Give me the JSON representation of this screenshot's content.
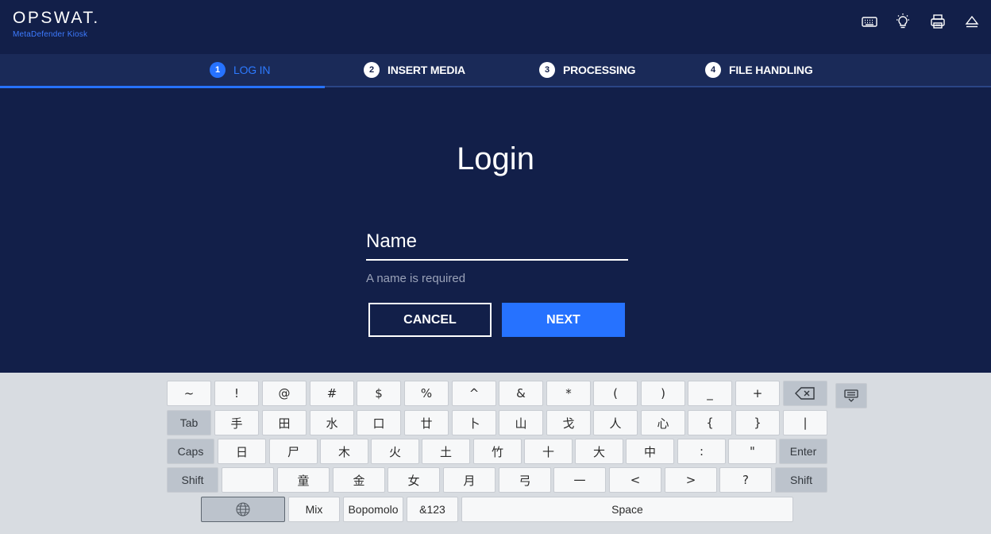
{
  "brand": {
    "name": "OPSWAT.",
    "product": "MetaDefender Kiosk"
  },
  "header_icons": [
    "keyboard-icon",
    "lightbulb-icon",
    "printer-icon",
    "eject-icon"
  ],
  "steps": [
    {
      "num": "1",
      "label": "LOG IN",
      "active": true
    },
    {
      "num": "2",
      "label": "INSERT MEDIA"
    },
    {
      "num": "3",
      "label": "PROCESSING"
    },
    {
      "num": "4",
      "label": "FILE HANDLING"
    }
  ],
  "login": {
    "title": "Login",
    "name_placeholder": "Name",
    "name_value": "",
    "hint": "A name is required",
    "cancel_label": "CANCEL",
    "next_label": "NEXT"
  },
  "colors": {
    "background": "#121f49",
    "stepper": "#1a2a58",
    "accent": "#2672ff"
  },
  "keyboard": {
    "row1": [
      "~",
      "!",
      "@",
      "#",
      "$",
      "%",
      "^",
      "&",
      "*",
      "(",
      ")",
      "_",
      "+"
    ],
    "row2": [
      "Tab",
      "手",
      "田",
      "水",
      "口",
      "廿",
      "卜",
      "山",
      "戈",
      "人",
      "心",
      "{",
      "}",
      "|"
    ],
    "row3": [
      "Caps",
      "日",
      "尸",
      "木",
      "火",
      "土",
      "竹",
      "十",
      "大",
      "中",
      ":",
      "\"",
      "Enter"
    ],
    "row4": [
      "Shift",
      "",
      "童",
      "金",
      "女",
      "月",
      "弓",
      "一",
      "<",
      ">",
      "?",
      "Shift"
    ],
    "row5": [
      "Mix",
      "Bopomolo",
      "&123",
      "Space"
    ]
  }
}
